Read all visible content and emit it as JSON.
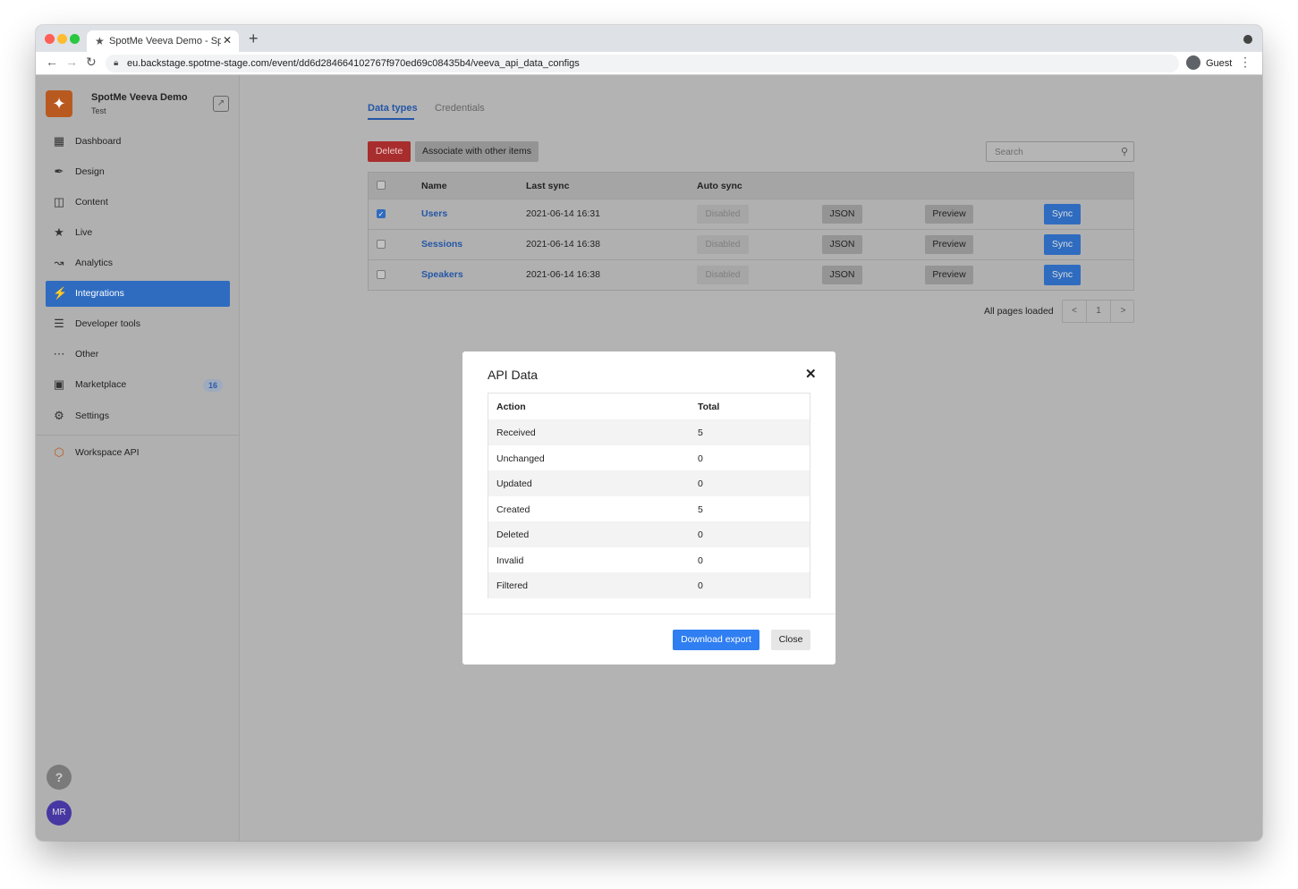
{
  "browser": {
    "tab_title": "SpotMe Veeva Demo - SpotMe",
    "url": "eu.backstage.spotme-stage.com/event/dd6d284664102767f970ed69c08435b4/veeva_api_data_configs",
    "profile_label": "Guest",
    "new_tab_glyph": "+",
    "close_glyph": "✕"
  },
  "sidebar": {
    "event_name": "SpotMe Veeva Demo",
    "event_sub": "Test",
    "items": [
      {
        "label": "Dashboard",
        "icon": "grid-icon"
      },
      {
        "label": "Design",
        "icon": "brush-icon"
      },
      {
        "label": "Content",
        "icon": "content-icon"
      },
      {
        "label": "Live",
        "icon": "star-icon"
      },
      {
        "label": "Analytics",
        "icon": "chart-icon"
      },
      {
        "label": "Integrations",
        "icon": "plug-icon",
        "active": true
      },
      {
        "label": "Developer tools",
        "icon": "database-icon"
      },
      {
        "label": "Other",
        "icon": "ellipsis-icon"
      },
      {
        "label": "Marketplace",
        "icon": "marketplace-icon",
        "badge": "16"
      },
      {
        "label": "Settings",
        "icon": "gear-icon"
      }
    ],
    "workspace": {
      "label": "Workspace API",
      "icon": "cube-icon"
    },
    "user_initials": "MR"
  },
  "main": {
    "tabs": [
      {
        "label": "Data types",
        "active": true
      },
      {
        "label": "Credentials",
        "active": false
      }
    ],
    "delete_label": "Delete",
    "associate_label": "Associate with other items",
    "search_placeholder": "Search",
    "columns": [
      "Name",
      "Last sync",
      "Auto sync"
    ],
    "rows": [
      {
        "name": "Users",
        "last_sync": "2021-06-14 16:31",
        "auto_sync": "Disabled",
        "json": "JSON",
        "preview": "Preview",
        "sync": "Sync",
        "checked": true
      },
      {
        "name": "Sessions",
        "last_sync": "2021-06-14 16:38",
        "auto_sync": "Disabled",
        "json": "JSON",
        "preview": "Preview",
        "sync": "Sync",
        "checked": false
      },
      {
        "name": "Speakers",
        "last_sync": "2021-06-14 16:38",
        "auto_sync": "Disabled",
        "json": "JSON",
        "preview": "Preview",
        "sync": "Sync",
        "checked": false
      }
    ],
    "pages_label": "All pages loaded",
    "pager": {
      "prev": "<",
      "page": "1",
      "next": ">"
    }
  },
  "modal": {
    "title": "API Data",
    "close_glyph": "✕",
    "columns": [
      "Action",
      "Total"
    ],
    "rows": [
      {
        "action": "Received",
        "total": "5"
      },
      {
        "action": "Unchanged",
        "total": "0"
      },
      {
        "action": "Updated",
        "total": "0"
      },
      {
        "action": "Created",
        "total": "5"
      },
      {
        "action": "Deleted",
        "total": "0"
      },
      {
        "action": "Invalid",
        "total": "0"
      },
      {
        "action": "Filtered",
        "total": "0"
      }
    ],
    "download_label": "Download export",
    "close_label": "Close"
  },
  "colors": {
    "accent": "#2f6cc0",
    "danger": "#a82d2d",
    "primary_button": "#2f7ef2"
  }
}
